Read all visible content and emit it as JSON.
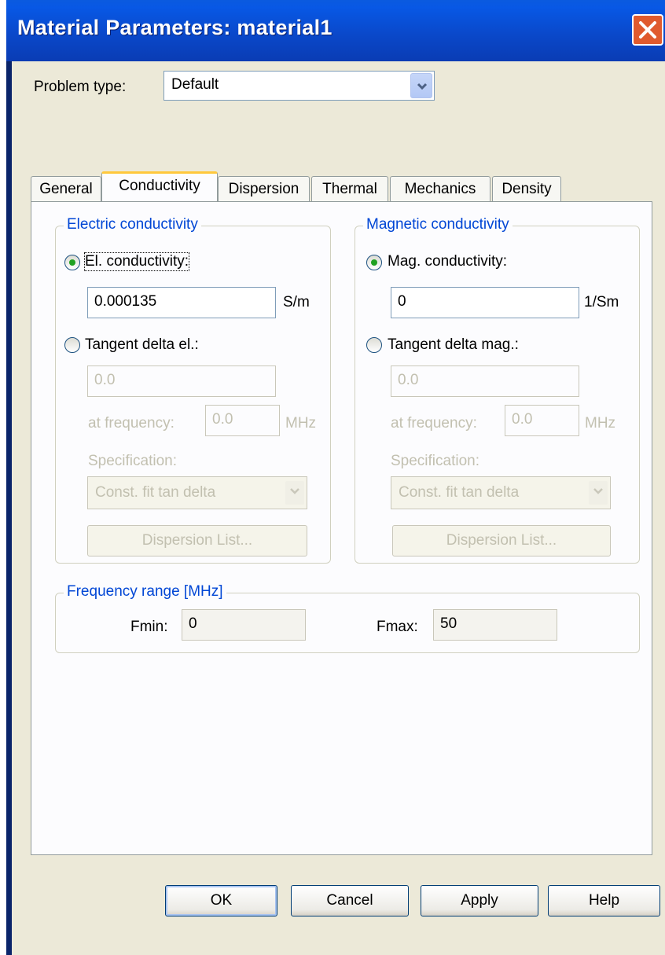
{
  "window": {
    "title": "Material Parameters: material1"
  },
  "problem_type": {
    "label": "Problem type:",
    "value": "Default"
  },
  "tabs": [
    {
      "label": "General",
      "active": false
    },
    {
      "label": "Conductivity",
      "active": true
    },
    {
      "label": "Dispersion",
      "active": false
    },
    {
      "label": "Thermal",
      "active": false
    },
    {
      "label": "Mechanics",
      "active": false
    },
    {
      "label": "Density",
      "active": false
    }
  ],
  "electric": {
    "group_title": "Electric conductivity",
    "conductivity_label": "El. conductivity:",
    "conductivity_value": "0.000135",
    "conductivity_unit": "S/m",
    "tangent_label": "Tangent delta el.:",
    "tangent_value": "0.0",
    "frequency_label": "at frequency:",
    "frequency_value": "0.0",
    "frequency_unit": "MHz",
    "specification_label": "Specification:",
    "specification_value": "Const. fit tan delta",
    "dispersion_button": "Dispersion List..."
  },
  "magnetic": {
    "group_title": "Magnetic conductivity",
    "conductivity_label": "Mag. conductivity:",
    "conductivity_value": "0",
    "conductivity_unit": "1/Sm",
    "tangent_label": "Tangent delta mag.:",
    "tangent_value": "0.0",
    "frequency_label": "at frequency:",
    "frequency_value": "0.0",
    "frequency_unit": "MHz",
    "specification_label": "Specification:",
    "specification_value": "Const. fit tan delta",
    "dispersion_button": "Dispersion List..."
  },
  "frequency_range": {
    "group_title": "Frequency range [MHz]",
    "fmin_label": "Fmin:",
    "fmin_value": "0",
    "fmax_label": "Fmax:",
    "fmax_value": "50"
  },
  "buttons": {
    "ok": "OK",
    "cancel": "Cancel",
    "apply": "Apply",
    "help": "Help"
  },
  "colors": {
    "titlebar": "#0a47c8",
    "group_title": "#0046d5",
    "dialog_bg": "#ece9d8",
    "tab_highlight": "#ffc83c"
  }
}
